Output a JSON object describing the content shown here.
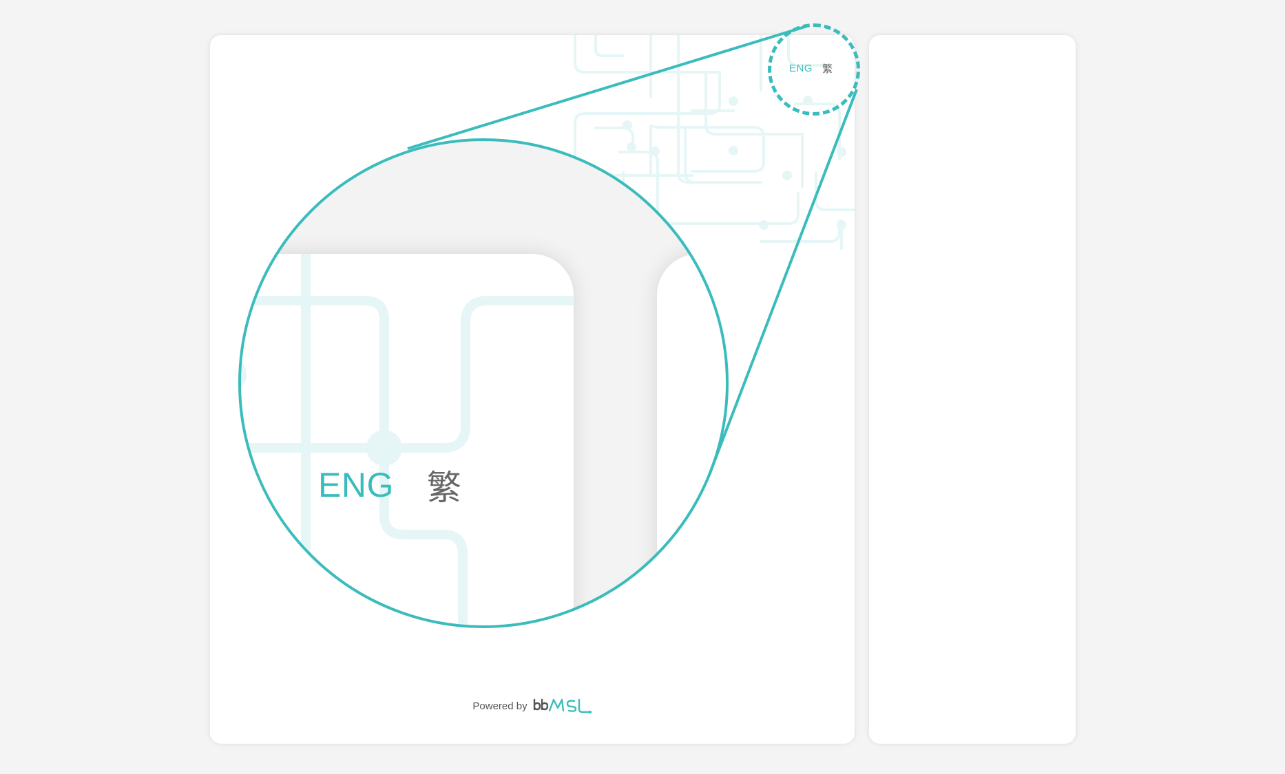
{
  "language_switch": {
    "active": "ENG",
    "inactive": "繁"
  },
  "footer": {
    "powered_by": "Powered by",
    "logo_text_prefix": "bb",
    "logo_text_main": "MSL"
  },
  "colors": {
    "accent": "#3bbcbc",
    "circuit": "#e6f6f6",
    "page_bg": "#f4f4f4",
    "card_bg": "#ffffff",
    "muted_text": "#666666"
  },
  "annotation": {
    "callout": "zoom-magnifier",
    "focus_target": "language-switch"
  }
}
